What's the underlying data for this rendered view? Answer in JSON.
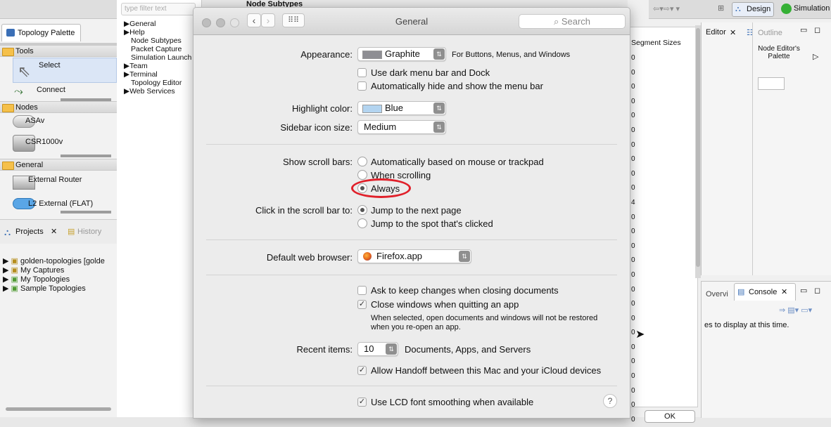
{
  "eclipse": {
    "filter_placeholder": "type filter text",
    "palette_tab": "Topology Palette",
    "drawers": {
      "tools": "Tools",
      "nodes": "Nodes",
      "general": "General"
    },
    "tools": [
      "Select",
      "Connect"
    ],
    "nodes": [
      "ASAv",
      "CSR1000v"
    ],
    "general_items": [
      "External Router",
      "L2 External (FLAT)"
    ],
    "projects_tab": "Projects",
    "history_tab": "History",
    "projects": [
      "golden-topologies  [golde",
      "My Captures",
      "My Topologies",
      "Sample Topologies"
    ],
    "tree_items": [
      "General",
      "Help",
      "Node Subtypes",
      "Packet Capture",
      "Simulation Launch",
      "Team",
      "Terminal",
      "Topology Editor",
      "Web Services"
    ],
    "node_subtypes_header": "Node Subtypes",
    "segment_header": "Segment Sizes",
    "segment_values": [
      "0",
      "0",
      "0",
      "0",
      "0",
      "0",
      "0",
      "0",
      "0",
      "0",
      "4",
      "0",
      "0",
      "0",
      "0",
      "0",
      "0",
      "0",
      "0",
      "0",
      "0",
      "0",
      "0",
      "0",
      "0",
      "0"
    ],
    "design_btn": "Design",
    "simulation_btn": "Simulation",
    "editor_tab": "Editor",
    "outline_tab": "Outline",
    "node_palette": "Node Editor's Palette",
    "overview_tab": "Overvi",
    "console_tab": "Console",
    "console_msg": "es to display at this time.",
    "ok_btn": "OK"
  },
  "dialog": {
    "title": "General",
    "search_placeholder": "Search",
    "appearance": {
      "label": "Appearance:",
      "value": "Graphite",
      "hint": "For Buttons, Menus, and Windows",
      "swatch_color": "#8e8e93"
    },
    "dark_menu": "Use dark menu bar and Dock",
    "auto_hide": "Automatically hide and show the menu bar",
    "highlight": {
      "label": "Highlight color:",
      "value": "Blue",
      "swatch_color": "#b3d4f0"
    },
    "sidebar": {
      "label": "Sidebar icon size:",
      "value": "Medium"
    },
    "scroll_bars": {
      "label": "Show scroll bars:",
      "options": [
        "Automatically based on mouse or trackpad",
        "When scrolling",
        "Always"
      ],
      "selected": "Always"
    },
    "click_scroll": {
      "label": "Click in the scroll bar to:",
      "options": [
        "Jump to the next page",
        "Jump to the spot that's clicked"
      ],
      "selected": "Jump to the next page"
    },
    "browser": {
      "label": "Default web browser:",
      "value": "Firefox.app"
    },
    "ask_keep": "Ask to keep changes when closing documents",
    "close_windows": "Close windows when quitting an app",
    "close_note": "When selected, open documents and windows will not be restored when you re-open an app.",
    "recent": {
      "label": "Recent items:",
      "value": "10",
      "suffix": "Documents, Apps, and Servers"
    },
    "handoff": "Allow Handoff between this Mac and your iCloud devices",
    "lcd": "Use LCD font smoothing when available",
    "help": "?"
  }
}
